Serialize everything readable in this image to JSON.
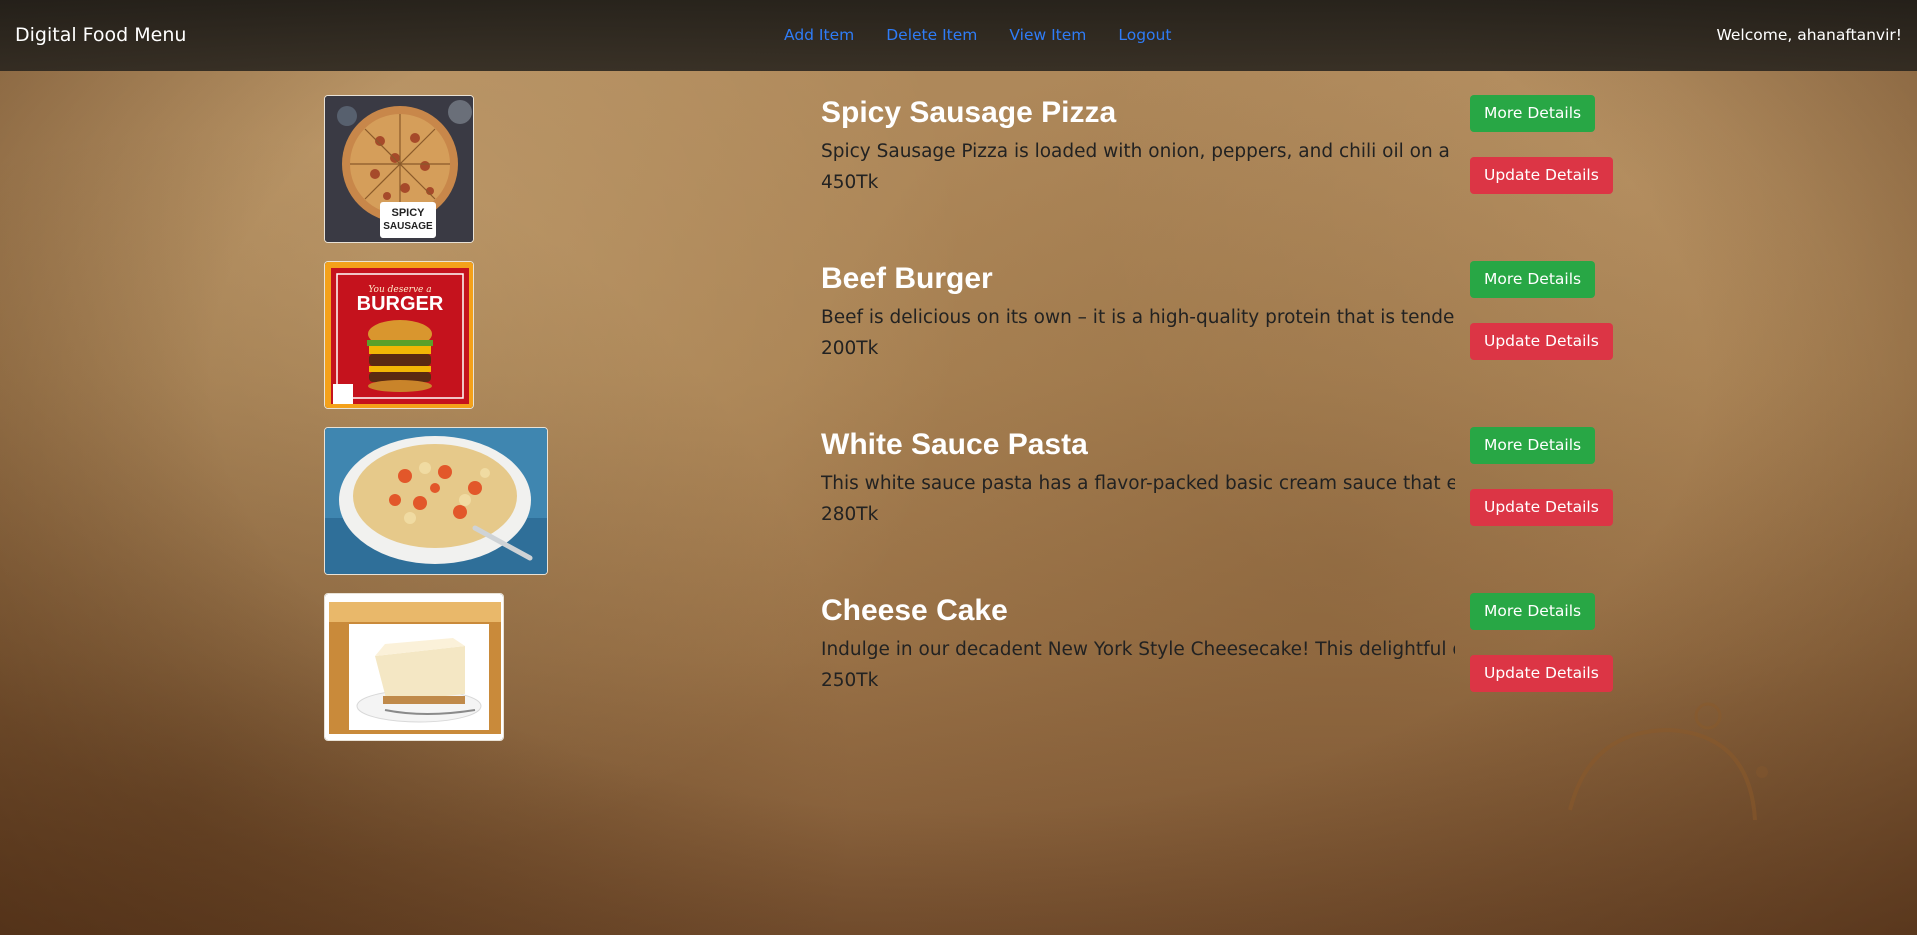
{
  "navbar": {
    "brand": "Digital Food Menu",
    "links": [
      "Add Item",
      "Delete Item",
      "View Item",
      "Logout"
    ],
    "welcome": "Welcome, ahanaftanvir!"
  },
  "menu": {
    "more_label": "More Details",
    "update_label": "Update Details",
    "items": [
      {
        "name": "Spicy Sausage Pizza",
        "description": "Spicy Sausage Pizza is loaded with onion, peppers, and chili oil on a ho",
        "price": "450Tk",
        "image_text": [
          "SPICY",
          "SAUSAGE"
        ]
      },
      {
        "name": "Beef Burger",
        "description": "Beef is delicious on its own – it is a high-quality protein that is tender",
        "price": "200Tk",
        "image_text": [
          "You deserve a",
          "BURGER"
        ]
      },
      {
        "name": "White Sauce Pasta",
        "description": "This white sauce pasta has a flavor-packed basic cream sauce that ever",
        "price": "280Tk"
      },
      {
        "name": "Cheese Cake",
        "description": "Indulge in our decadent New York Style Cheesecake! This delightful de",
        "price": "250Tk"
      }
    ]
  },
  "colors": {
    "link": "#2f7cf6",
    "more_button": "#28a745",
    "update_button": "#dc3545"
  }
}
